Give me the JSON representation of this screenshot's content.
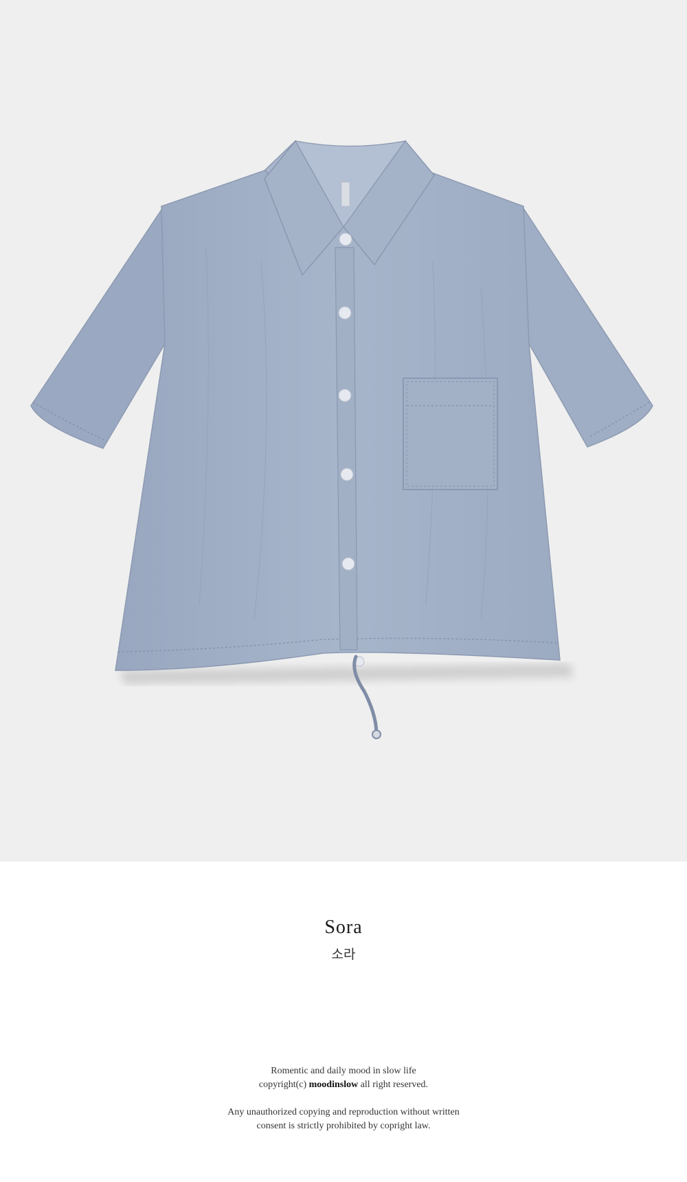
{
  "product_photo": {
    "subject": "shirt-illustration",
    "colors": {
      "background": "#efefef",
      "fabric": "#a4b2c9",
      "fabric_shadow": "#8e9cb4",
      "fabric_highlight": "#b6c2d6",
      "stitch": "#8392ab",
      "button": "#e6e9ef",
      "cord": "#7f8da6"
    }
  },
  "color_option": {
    "name_en": "Sora",
    "name_ko": "소라"
  },
  "footer": {
    "tagline": "Romentic and daily mood in slow life",
    "copyright_prefix": "copyright(c) ",
    "brand": "moodinslow",
    "copyright_suffix": " all right reserved.",
    "notice_line1": "Any unauthorized copying and reproduction without written",
    "notice_line2": "consent is strictly prohibited by copright law."
  }
}
